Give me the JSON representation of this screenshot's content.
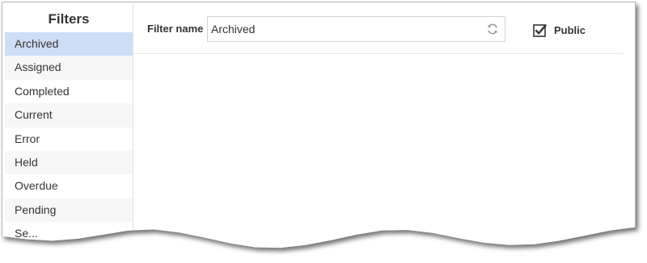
{
  "sidebar": {
    "title": "Filters",
    "items": [
      {
        "label": "Archived"
      },
      {
        "label": "Assigned"
      },
      {
        "label": "Completed"
      },
      {
        "label": "Current"
      },
      {
        "label": "Error"
      },
      {
        "label": "Held"
      },
      {
        "label": "Overdue"
      },
      {
        "label": "Pending"
      },
      {
        "label": "Se..."
      }
    ],
    "selected_index": 0
  },
  "form": {
    "filter_name_label": "Filter name",
    "filter_name_value": "Archived",
    "public_label": "Public",
    "public_checked": true
  },
  "icons": {
    "refresh": "refresh-icon",
    "checkbox": "checkbox-checked-icon"
  },
  "colors": {
    "selected_row": "#cfdcf5",
    "alt_row": "#f7f7f7"
  }
}
